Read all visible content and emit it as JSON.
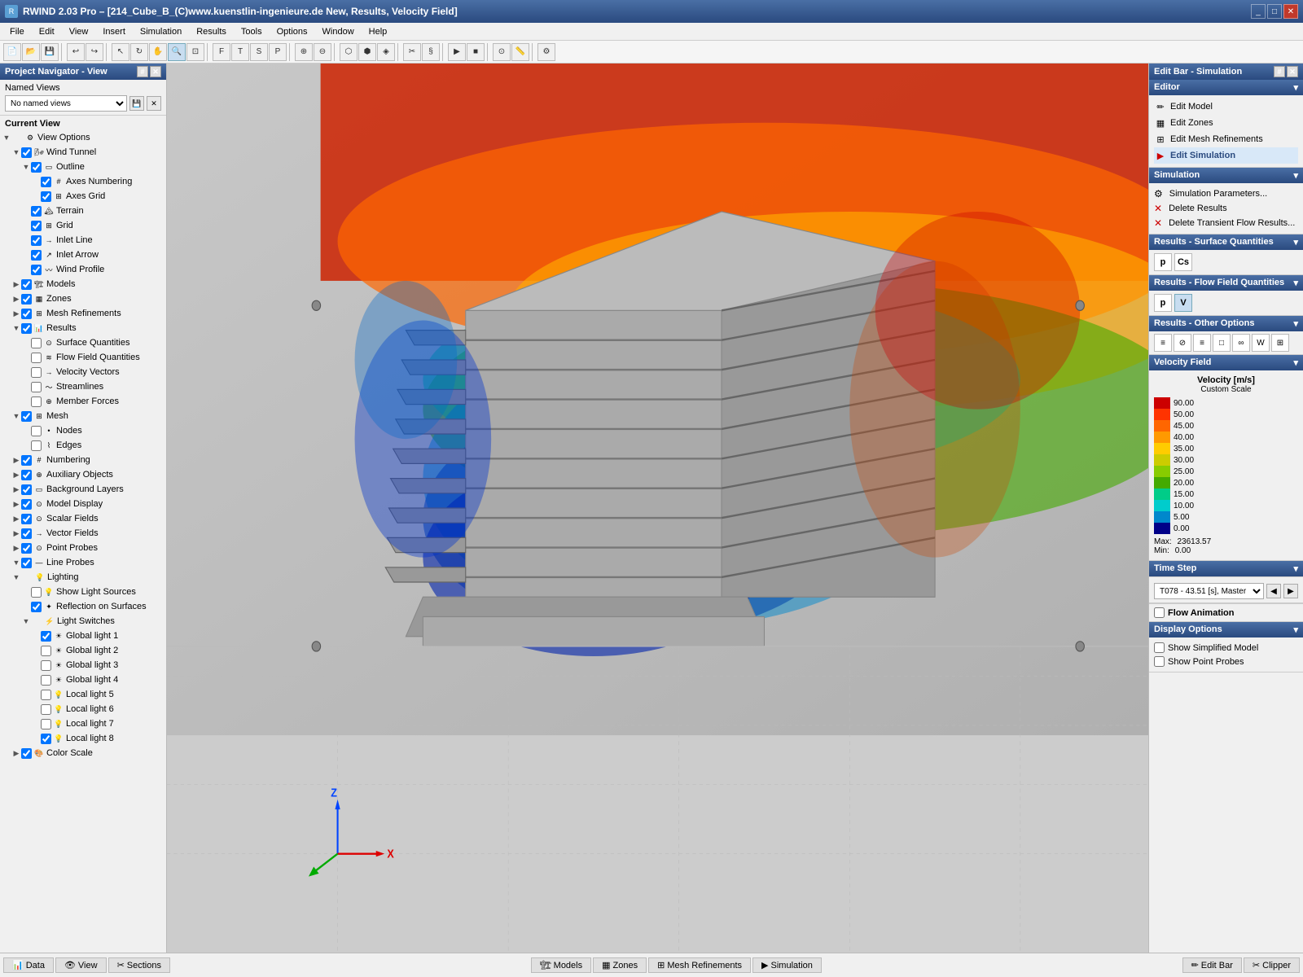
{
  "titleBar": {
    "title": "RWIND 2.03 Pro – [214_Cube_B_(C)www.kuenstlin-ingenieure.de New, Results, Velocity Field]",
    "controls": [
      "_",
      "□",
      "✕"
    ]
  },
  "menuBar": {
    "items": [
      "File",
      "Edit",
      "View",
      "Insert",
      "Simulation",
      "Results",
      "Tools",
      "Options",
      "Window",
      "Help"
    ]
  },
  "leftPanel": {
    "title": "Project Navigator - View",
    "namedViews": {
      "label": "Named Views",
      "placeholder": "No named views"
    },
    "currentView": {
      "label": "Current View"
    },
    "tree": [
      {
        "id": "view-options",
        "label": "View Options",
        "level": 0,
        "expanded": true,
        "checked": true,
        "hasCheck": false
      },
      {
        "id": "wind-tunnel",
        "label": "Wind Tunnel",
        "level": 1,
        "expanded": true,
        "checked": true,
        "hasCheck": true
      },
      {
        "id": "outline",
        "label": "Outline",
        "level": 2,
        "expanded": true,
        "checked": true,
        "hasCheck": true
      },
      {
        "id": "axes-numbering",
        "label": "Axes Numbering",
        "level": 3,
        "checked": true,
        "hasCheck": true
      },
      {
        "id": "axes-grid",
        "label": "Axes Grid",
        "level": 3,
        "checked": true,
        "hasCheck": true
      },
      {
        "id": "terrain",
        "label": "Terrain",
        "level": 2,
        "checked": true,
        "hasCheck": true
      },
      {
        "id": "grid",
        "label": "Grid",
        "level": 2,
        "checked": true,
        "hasCheck": true
      },
      {
        "id": "inlet-line",
        "label": "Inlet Line",
        "level": 2,
        "checked": true,
        "hasCheck": true
      },
      {
        "id": "inlet-arrow",
        "label": "Inlet Arrow",
        "level": 2,
        "checked": true,
        "hasCheck": true
      },
      {
        "id": "wind-profile",
        "label": "Wind Profile",
        "level": 2,
        "checked": true,
        "hasCheck": true
      },
      {
        "id": "models",
        "label": "Models",
        "level": 1,
        "expanded": false,
        "checked": true,
        "hasCheck": true
      },
      {
        "id": "zones",
        "label": "Zones",
        "level": 1,
        "expanded": false,
        "checked": true,
        "hasCheck": true
      },
      {
        "id": "mesh-refinements",
        "label": "Mesh Refinements",
        "level": 1,
        "expanded": false,
        "checked": true,
        "hasCheck": true
      },
      {
        "id": "results",
        "label": "Results",
        "level": 1,
        "expanded": true,
        "checked": true,
        "hasCheck": true
      },
      {
        "id": "surface-quantities",
        "label": "Surface Quantities",
        "level": 2,
        "checked": false,
        "hasCheck": true
      },
      {
        "id": "flow-field-quantities",
        "label": "Flow Field Quantities",
        "level": 2,
        "checked": false,
        "hasCheck": true
      },
      {
        "id": "velocity-vectors",
        "label": "Velocity Vectors",
        "level": 2,
        "checked": false,
        "hasCheck": true
      },
      {
        "id": "streamlines",
        "label": "Streamlines",
        "level": 2,
        "checked": false,
        "hasCheck": true
      },
      {
        "id": "member-forces",
        "label": "Member Forces",
        "level": 2,
        "checked": false,
        "hasCheck": true
      },
      {
        "id": "mesh",
        "label": "Mesh",
        "level": 1,
        "expanded": true,
        "checked": true,
        "hasCheck": true
      },
      {
        "id": "nodes",
        "label": "Nodes",
        "level": 2,
        "checked": false,
        "hasCheck": true
      },
      {
        "id": "edges",
        "label": "Edges",
        "level": 2,
        "checked": false,
        "hasCheck": true
      },
      {
        "id": "numbering",
        "label": "Numbering",
        "level": 1,
        "expanded": false,
        "checked": true,
        "hasCheck": true
      },
      {
        "id": "auxiliary-objects",
        "label": "Auxiliary Objects",
        "level": 1,
        "expanded": false,
        "checked": true,
        "hasCheck": true
      },
      {
        "id": "background-layers",
        "label": "Background Layers",
        "level": 1,
        "expanded": false,
        "checked": true,
        "hasCheck": true
      },
      {
        "id": "model-display",
        "label": "Model Display",
        "level": 1,
        "expanded": false,
        "checked": true,
        "hasCheck": true
      },
      {
        "id": "scalar-fields",
        "label": "Scalar Fields",
        "level": 1,
        "expanded": false,
        "checked": true,
        "hasCheck": true
      },
      {
        "id": "vector-fields",
        "label": "Vector Fields",
        "level": 1,
        "expanded": false,
        "checked": true,
        "hasCheck": true
      },
      {
        "id": "point-probes",
        "label": "Point Probes",
        "level": 1,
        "expanded": false,
        "checked": true,
        "hasCheck": true
      },
      {
        "id": "line-probes",
        "label": "Line Probes",
        "level": 1,
        "expanded": true,
        "checked": true,
        "hasCheck": true
      },
      {
        "id": "lighting",
        "label": "Lighting",
        "level": 1,
        "expanded": true,
        "checked": true,
        "hasCheck": false
      },
      {
        "id": "show-light-sources",
        "label": "Show Light Sources",
        "level": 2,
        "checked": false,
        "hasCheck": true
      },
      {
        "id": "reflection-on-surfaces",
        "label": "Reflection on Surfaces",
        "level": 2,
        "checked": true,
        "hasCheck": true
      },
      {
        "id": "light-switches",
        "label": "Light Switches",
        "level": 2,
        "expanded": true,
        "checked": true,
        "hasCheck": false
      },
      {
        "id": "global-light-1",
        "label": "Global light 1",
        "level": 3,
        "checked": true,
        "hasCheck": true
      },
      {
        "id": "global-light-2",
        "label": "Global light 2",
        "level": 3,
        "checked": false,
        "hasCheck": true
      },
      {
        "id": "global-light-3",
        "label": "Global light 3",
        "level": 3,
        "checked": false,
        "hasCheck": true
      },
      {
        "id": "global-light-4",
        "label": "Global light 4",
        "level": 3,
        "checked": false,
        "hasCheck": true
      },
      {
        "id": "local-light-5",
        "label": "Local light 5",
        "level": 3,
        "checked": false,
        "hasCheck": true
      },
      {
        "id": "local-light-6",
        "label": "Local light 6",
        "level": 3,
        "checked": false,
        "hasCheck": true
      },
      {
        "id": "local-light-7",
        "label": "Local light 7",
        "level": 3,
        "checked": false,
        "hasCheck": true
      },
      {
        "id": "local-light-8",
        "label": "Local light 8",
        "level": 3,
        "checked": true,
        "hasCheck": true
      },
      {
        "id": "color-scale",
        "label": "Color Scale",
        "level": 1,
        "expanded": false,
        "checked": true,
        "hasCheck": true
      }
    ]
  },
  "rightPanel": {
    "title": "Edit Bar - Simulation",
    "editor": {
      "title": "Editor",
      "items": [
        {
          "id": "edit-model",
          "label": "Edit Model",
          "icon": "✏️"
        },
        {
          "id": "edit-zones",
          "label": "Edit Zones",
          "icon": "▦"
        },
        {
          "id": "edit-mesh-refinements",
          "label": "Edit Mesh Refinements",
          "icon": "⊞"
        },
        {
          "id": "edit-simulation",
          "label": "Edit Simulation",
          "icon": "▶",
          "bold": true
        }
      ]
    },
    "simulation": {
      "title": "Simulation",
      "items": [
        {
          "id": "simulation-parameters",
          "label": "Simulation Parameters...",
          "icon": "⚙"
        },
        {
          "id": "delete-results",
          "label": "Delete Results",
          "icon": "✕"
        },
        {
          "id": "delete-transient",
          "label": "Delete Transient Flow Results...",
          "icon": "✕"
        }
      ]
    },
    "resultsSurface": {
      "title": "Results - Surface Quantities",
      "buttons": [
        {
          "id": "pressure-btn",
          "label": "p",
          "active": false
        },
        {
          "id": "cp-btn",
          "label": "Cs",
          "active": false
        }
      ]
    },
    "resultsFlow": {
      "title": "Results - Flow Field Quantities",
      "buttons": [
        {
          "id": "p-flow-btn",
          "label": "p",
          "active": false
        },
        {
          "id": "v-flow-btn",
          "label": "V",
          "active": true
        }
      ]
    },
    "resultsOther": {
      "title": "Results - Other Options",
      "buttons": [
        "≡",
        "⊘",
        "≡",
        "□",
        "∞",
        "W",
        "⊞"
      ]
    },
    "velocityField": {
      "title": "Velocity Field",
      "legendTitle": "Velocity [m/s]",
      "legendSubtitle": "Custom Scale",
      "colorScale": [
        {
          "value": "90.00",
          "color": "#cc0000"
        },
        {
          "value": "50.00",
          "color": "#ff3300"
        },
        {
          "value": "45.00",
          "color": "#ff6600"
        },
        {
          "value": "40.00",
          "color": "#ff9900"
        },
        {
          "value": "35.00",
          "color": "#ffcc00"
        },
        {
          "value": "30.00",
          "color": "#cccc00"
        },
        {
          "value": "25.00",
          "color": "#88cc00"
        },
        {
          "value": "20.00",
          "color": "#44aa00"
        },
        {
          "value": "15.00",
          "color": "#00cc88"
        },
        {
          "value": "10.00",
          "color": "#00cccc"
        },
        {
          "value": "5.00",
          "color": "#0088cc"
        },
        {
          "value": "0.00",
          "color": "#000088"
        }
      ],
      "maxLabel": "Max:",
      "maxValue": "23613.57",
      "minLabel": "Min:",
      "minValue": "0.00"
    },
    "timeStep": {
      "title": "Time Step",
      "value": "T078 - 43.51 [s], Master"
    },
    "flowAnimation": {
      "label": "Flow Animation",
      "checked": false
    },
    "displayOptions": {
      "title": "Display Options",
      "items": [
        {
          "id": "show-simplified-model",
          "label": "Show Simplified Model",
          "checked": false
        },
        {
          "id": "show-point-probes",
          "label": "Show Point Probes",
          "checked": false
        }
      ]
    }
  },
  "statusBar": {
    "leftTabs": [
      {
        "id": "data-tab",
        "label": "Data",
        "icon": "📊"
      },
      {
        "id": "view-tab",
        "label": "View",
        "icon": "👁"
      },
      {
        "id": "sections-tab",
        "label": "Sections",
        "icon": "✂"
      }
    ],
    "centerTabs": [
      {
        "id": "models-tab",
        "label": "Models",
        "icon": "🏗"
      },
      {
        "id": "zones-tab",
        "label": "Zones",
        "icon": "▦"
      },
      {
        "id": "mesh-refinements-tab",
        "label": "Mesh Refinements",
        "icon": "⊞"
      },
      {
        "id": "simulation-tab",
        "label": "Simulation",
        "icon": "▶"
      }
    ],
    "rightTabs": [
      {
        "id": "edit-bar-tab",
        "label": "Edit Bar",
        "icon": "✏️"
      },
      {
        "id": "clipper-tab",
        "label": "Clipper",
        "icon": "✂"
      }
    ]
  }
}
